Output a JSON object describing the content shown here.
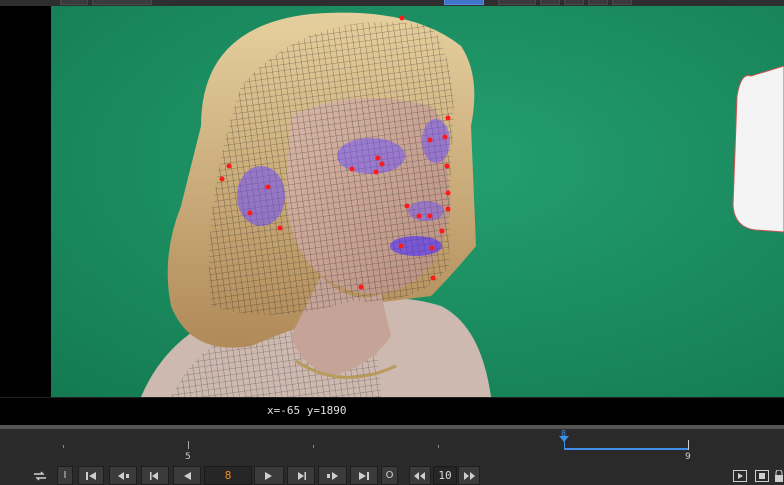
{
  "viewer": {
    "coordinate_readout": "x=-65 y=1890"
  },
  "timeline": {
    "ticks": [
      {
        "label": "5"
      },
      {
        "label": "9"
      }
    ],
    "current_frame_marker": "8"
  },
  "transport": {
    "in_label": "I",
    "out_label": "O",
    "current_frame": "8",
    "step_increment": "10"
  },
  "colors": {
    "greenscreen": "#1f8f63",
    "accent": "#3f8ee8",
    "frame_text": "#f08a2c",
    "tracker_point": "#ff1a1a",
    "mesh_overlay": "#6a4dff"
  },
  "icons": {
    "loop": "loop-icon",
    "first_frame": "skip-to-start-icon",
    "prev_keyframe": "prev-keyframe-icon",
    "play_backward_step": "step-back-icon",
    "play_backward": "play-backward-icon",
    "play_forward": "play-forward-icon",
    "step_forward": "step-forward-icon",
    "next_keyframe": "next-keyframe-icon",
    "last_frame": "skip-to-end-icon",
    "decrement": "decrement-icon",
    "increment": "increment-icon",
    "play_right": "play-right-icon",
    "stop": "stop-icon",
    "lock": "lock-icon"
  }
}
